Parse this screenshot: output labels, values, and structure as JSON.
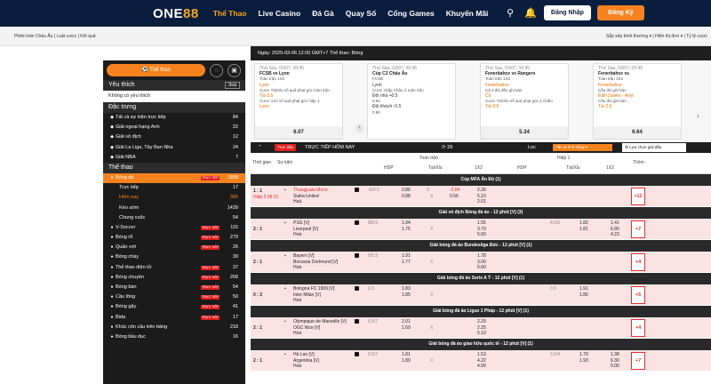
{
  "header": {
    "logo_main": "ONE",
    "logo_accent": "88",
    "nav": [
      "Thể Thao",
      "Live Casino",
      "Đá Gà",
      "Quay Số",
      "Cổng Games",
      "Khuyến Mãi"
    ],
    "login": "Đăng Nhập",
    "register": "Đăng Ký"
  },
  "subbar": {
    "left": "Phiên bản Châu Âu | Luật cược | Kết quả",
    "right": "Sắp xếp bình thường ▾ | Hiển thị đơn ▾ | Tỷ lệ cược"
  },
  "sidebar": {
    "sports_btn": "Thể thao",
    "favorites_title": "Yêu thích",
    "clear": "Xoá",
    "no_favorites": "Không có yêu thích",
    "featured_title": "Đặc trưng",
    "featured": [
      {
        "label": "Tất cả sự kiện trực tiếp",
        "count": "84",
        "live": false
      },
      {
        "label": "Giải ngoại hạng Anh",
        "count": "22",
        "live": false
      },
      {
        "label": "Giải vô địch",
        "count": "12",
        "live": false
      },
      {
        "label": "Giải La Liga, Tây Ban Nha",
        "count": "24",
        "live": false
      },
      {
        "label": "Giải NBA",
        "count": "7",
        "live": false
      }
    ],
    "sports_title": "Thể thao",
    "sports": [
      {
        "label": "Bóng đá",
        "count": "1858",
        "live": true,
        "selected": true
      },
      {
        "label": "Trực tiếp",
        "count": "17",
        "sub": true
      },
      {
        "label": "Hôm nay",
        "count": "365",
        "sub": true,
        "accent": true
      },
      {
        "label": "Kèo sớm",
        "count": "1439",
        "sub": true
      },
      {
        "label": "Chung cuộc",
        "count": "54",
        "sub": true
      },
      {
        "label": "V-Soccer",
        "count": "115",
        "live": true
      },
      {
        "label": "Bóng rổ",
        "count": "279",
        "live": true
      },
      {
        "label": "Quần vợt",
        "count": "26",
        "live": true
      },
      {
        "label": "Bóng chày",
        "count": "39",
        "live": false
      },
      {
        "label": "Thể thao điện tử",
        "count": "37",
        "live": true
      },
      {
        "label": "Bóng chuyền",
        "count": "268",
        "live": true
      },
      {
        "label": "Bóng bàn",
        "count": "54",
        "live": true
      },
      {
        "label": "Cầu lông",
        "count": "50",
        "live": true
      },
      {
        "label": "Bóng gậy",
        "count": "41",
        "live": true
      },
      {
        "label": "Bida",
        "count": "17",
        "live": true
      },
      {
        "label": "Khúc côn cầu trên băng",
        "count": "218",
        "live": false
      },
      {
        "label": "Bóng bầu dục",
        "count": "16",
        "live": false
      }
    ],
    "live_tag": "TRỰC TIẾP"
  },
  "main": {
    "datebar": "Ngày: 2025-03-06 12:00 GMT+7 Thể thao: Bóng",
    "cards": [
      {
        "head": "Thứ Sáu, 03/07, 00:45",
        "match": "FCSB vs Lyon",
        "l1": "Toàn trận 1X2",
        "l2": "Lyon",
        "l3": "Cược Tài/Xỉu số quả phạt góc toàn trận",
        "l4": "Tài 9.5",
        "l5": "Cược 1X2 số quả phạt góc hiệp 1",
        "l6": "Lyon",
        "total": "6.07"
      },
      {
        "head": "Thứ Sáu, 03/07, 00:45",
        "match": "Cúp C2 Châu Âu",
        "l1": "FCSB",
        "l2": "Lyon",
        "l3": "Cược chấp Châu Á toàn trận",
        "l4": "Đội nhà +0.5",
        "l5": "0.94",
        "l6": "Đội khách -0.5",
        "l7": "0.90"
      },
      {
        "head": "Thứ Sáu, 03/07, 00:45",
        "match": "Fenerbahce vs Rangers",
        "l1": "Toàn trận 1X2",
        "l2": "Fenerbahce",
        "l3": "Cả 2 đội đều ghi bàn",
        "l4": "Có",
        "l5": "Cược Tài/Xỉu số quả phạt góc 2 chiều",
        "l6": "Tài 9.5",
        "total": "5.34"
      },
      {
        "head": "Thứ Sáu, 03/07, 00:45",
        "match": "Fenerbahce vs",
        "l1": "Toàn trận 1X2",
        "l2": "Fenerbahce",
        "l3": "Cầu thủ ghi bàn",
        "l4": "Edin Dzeko - Anyt",
        "l5": "Cầu thủ ghi bàn",
        "l6": "Tài 2.5",
        "total": "6.64"
      }
    ],
    "tbar": {
      "live": "Trực tiếp",
      "title": "TRỰC TIẾP HÔM NAY",
      "count": "28",
      "filter": "Lọc",
      "select": "Tất cả tình năng",
      "choose": "Lựa chọn giải đấu"
    },
    "thead": {
      "time": "Thời gian",
      "event": "Sự kiện",
      "full": "Toàn trận",
      "half": "Hiệp 1",
      "more": "Thêm",
      "hdp": "HDP",
      "ou": "Tài/Xỉu",
      "x12": "1X2"
    },
    "leagues": [
      {
        "name": "Cúp MFA Ấn Độ (1)",
        "rows": [
          {
            "score": "1 : 1",
            "sub": "Hiệp 2 68:31",
            "home": "Thangjuala Mono",
            "away": "Siaha United",
            "draw": "Hoà",
            "hdp1": "-0/0.5",
            "hdp2": "0.86",
            "hdp3": "0.88",
            "ou1": "3",
            "ou2": "-0.84",
            "ou3": "0.56",
            "x1": "2.26",
            "x2": "5.10",
            "x3": "2.01",
            "plus": "+12"
          }
        ]
      },
      {
        "name": "Giải vô địch Bóng đá ảo - 12 phút [V] (3)",
        "rows": [
          {
            "score": "2 : 1",
            "home": "PSG [V]",
            "away": "Liverpool [V]",
            "draw": "Hoà",
            "hdp1": "8/8.5",
            "hdp2": "1.94",
            "hdp3": "1.75",
            "x1": "1.55",
            "x2": "3.79",
            "x3": "5.60",
            "h1": "4.5/5",
            "h2": "1.82",
            "h3": "1.81",
            "hx1": "1.41",
            "hx2": "6.90",
            "hx3": "4.23",
            "plus": "+7"
          }
        ]
      },
      {
        "name": "Giải bóng đá ảo Bundesliga Đức - 12 phút [V] (1)",
        "rows": [
          {
            "score": "2 : 1",
            "home": "Bayern [V]",
            "away": "Borussia Dortmund [V]",
            "draw": "Hoà",
            "hdp1": "5/5.5",
            "hdp2": "1.91",
            "hdp3": "1.77",
            "x1": "1.78",
            "x2": "3.00",
            "x3": "5.60",
            "plus": "+4"
          }
        ]
      },
      {
        "name": "Giải bóng đá ảo Serie A Ý - 12 phút [V] (1)",
        "rows": [
          {
            "score": "0 : 2",
            "home": "Bologna FC 1909 [V]",
            "away": "Inter Milan [V]",
            "draw": "Hoà",
            "hdp1": "6.5",
            "hdp2": "1.83",
            "hdp3": "1.85",
            "h1": "3.5",
            "h2": "1.91",
            "h3": "1.86",
            "plus": "+5"
          }
        ]
      },
      {
        "name": "Giải bóng đá ảo Ligue 1 Pháp - 12 phút [V] (1)",
        "rows": [
          {
            "score": "2 : 1",
            "home": "Olympique de Marseille [V]",
            "away": "OGC Nice [V]",
            "draw": "Hoà",
            "hdp1": "6.5/7",
            "hdp2": "2.01",
            "hdp3": "1.69",
            "x1": "2.29",
            "x2": "2.25",
            "x3": "5.10",
            "plus": "+4"
          }
        ]
      },
      {
        "name": "Giải bóng đá ảo giao hữu quốc tế - 12 phút [V] (1)",
        "rows": [
          {
            "score": "2 : 1",
            "home": "Hà Lan [V]",
            "away": "Argentina [V]",
            "draw": "Hoà",
            "hdp1": "6.5/7",
            "hdp2": "1.81",
            "hdp3": "1.89",
            "x1": "1.53",
            "x2": "4.22",
            "x3": "4.90",
            "h1": "3.5/4",
            "h2": "1.79",
            "h3": "1.93",
            "hx1": "1.38",
            "hx2": "6.30",
            "hx3": "5.00",
            "plus": "+7"
          }
        ]
      }
    ]
  }
}
